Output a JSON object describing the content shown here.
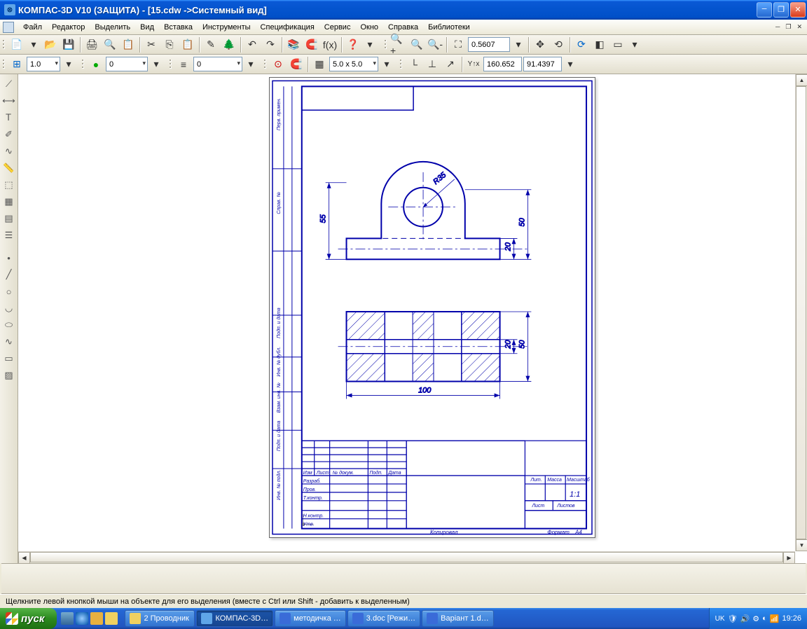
{
  "title": "КОМПАС-3D V10 (ЗАЩИТА) - [15.cdw ->Системный вид]",
  "menu": [
    "Файл",
    "Редактор",
    "Выделить",
    "Вид",
    "Вставка",
    "Инструменты",
    "Спецификация",
    "Сервис",
    "Окно",
    "Справка",
    "Библиотеки"
  ],
  "toolbar2": {
    "scale": "1.0",
    "layer": "0",
    "style": "0",
    "grid": "5.0 x 5.0",
    "zoom": "0.5607",
    "coordX": "160.652",
    "coordY": "91.4397",
    "xy_label": "Y↑x"
  },
  "drawing": {
    "dims": {
      "h55": "55",
      "h50": "50",
      "h20a": "20",
      "h100": "100",
      "h50b": "50",
      "h20b": "20",
      "r35": "R35"
    },
    "titleblock": {
      "col_izm": "Изм",
      "col_list": "Лист",
      "col_ndoc": "№ докум.",
      "col_podp": "Подп.",
      "col_data": "Дата",
      "row_razrab": "Разраб.",
      "row_prov": "Пров.",
      "row_tcontr": "Т.контр.",
      "row_ncontr": "Н.контр.",
      "row_utv": "Утв.",
      "lit": "Лит.",
      "massa": "Масса",
      "masshtab": "Масштаб",
      "scale": "1:1",
      "list": "Лист",
      "listov": "Листов",
      "kopiroval": "Копировал",
      "format": "Формат",
      "a4": "A4",
      "left_perv": "Перв. примен.",
      "left_sprav": "Справ. №",
      "left_podp_data": "Подп. и дата",
      "left_inv_dubl": "Инв. № дубл.",
      "left_vzam": "Взам. инв. №",
      "left_podp_data2": "Подп. и дата",
      "left_inv_podl": "Инв. № подл."
    }
  },
  "status": "Щелкните левой кнопкой мыши на объекте для его выделения (вместе с Ctrl или Shift - добавить к выделенным)",
  "taskbar": {
    "start": "пуск",
    "items": [
      {
        "label": "2 Проводник",
        "grouped": true
      },
      {
        "label": "КОМПАС-3D…",
        "active": true
      },
      {
        "label": "методичка …"
      },
      {
        "label": "3.doc [Режи…"
      },
      {
        "label": "Варіант 1.d…"
      }
    ],
    "lang": "UK",
    "time": "19:26"
  }
}
